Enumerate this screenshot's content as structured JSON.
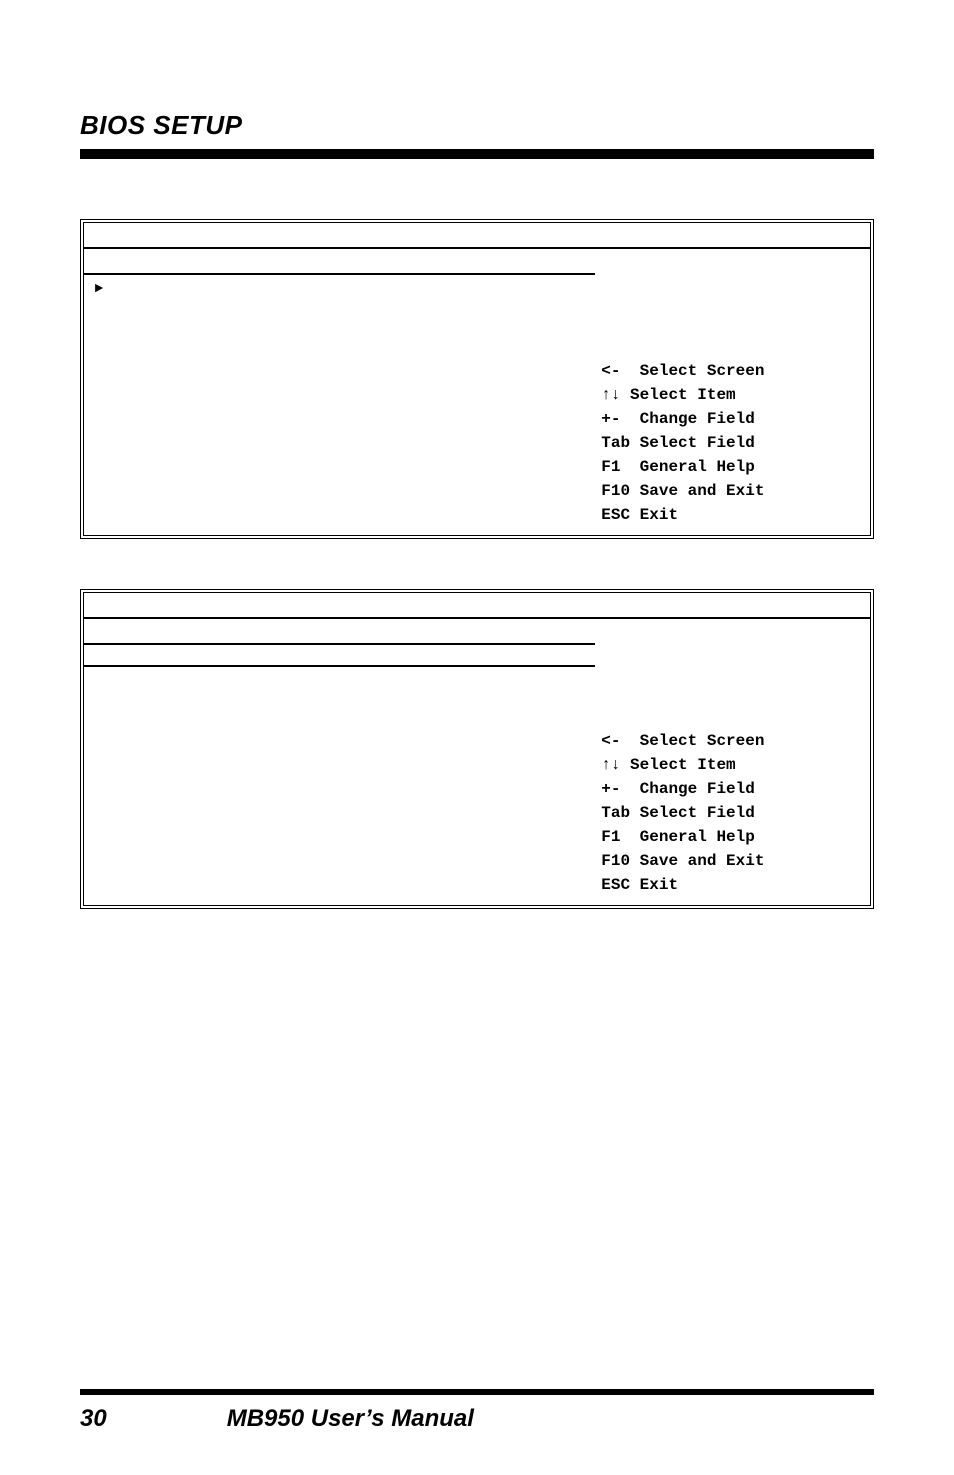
{
  "header": "BIOS SETUP",
  "box1": {
    "marker": "►"
  },
  "box2": {},
  "help": {
    "l1": "<-  Select Screen",
    "l2": "↑↓ Select Item",
    "l3": "+-  Change Field",
    "l4": "Tab Select Field",
    "l5": "F1  General Help",
    "l6": "F10 Save and Exit",
    "l7": "ESC Exit"
  },
  "footer": {
    "page": "30",
    "title": "MB950 User’s Manual"
  }
}
